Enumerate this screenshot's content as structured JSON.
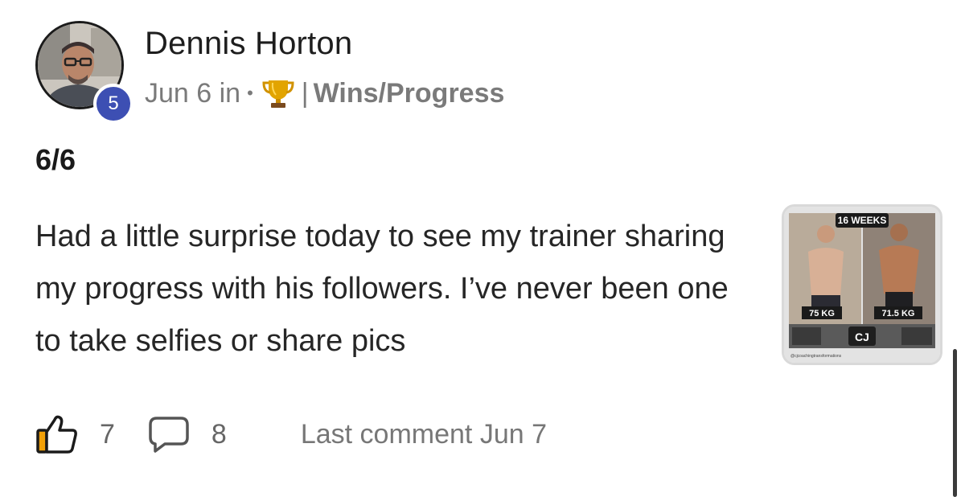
{
  "post": {
    "author": {
      "name": "Dennis Horton",
      "level": "5"
    },
    "meta": {
      "date": "Jun 6 in",
      "separator": "•",
      "category_bar": "|",
      "category": "Wins/Progress",
      "category_icon": "trophy-icon"
    },
    "title": "6/6",
    "body": "Had a little surprise today to see my trainer sharing my progress with his followers. I’ve never been one to take selfies or share pics",
    "thumbnail": {
      "banner": "16 WEEKS",
      "before_weight": "75 KG",
      "after_weight": "71.5 KG",
      "logo": "CJ",
      "handle": "@cjcoachingtransformations"
    },
    "footer": {
      "likes": "7",
      "comments": "8",
      "last_comment": "Last comment Jun 7"
    }
  },
  "colors": {
    "badge": "#3d4fb3",
    "text_primary": "#1e1e1e",
    "text_muted": "#7a7a7a",
    "trophy": "#e2a400"
  }
}
